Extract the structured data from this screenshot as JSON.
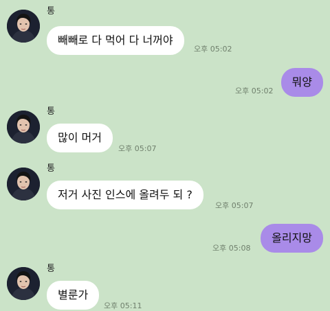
{
  "colors": {
    "background": "#cbe3c8",
    "incoming_bubble": "#ffffff",
    "outgoing_bubble": "#a98be8",
    "time_text": "#6f7f6c"
  },
  "messages": [
    {
      "sender": "통",
      "text": "빼빼로 다 먹어 다 너꺼야",
      "time": "오후 05:02",
      "direction": "in"
    },
    {
      "text": "뭐양",
      "time": "오후 05:02",
      "direction": "out"
    },
    {
      "sender": "통",
      "text": "많이 머거",
      "time": "오후 05:07",
      "direction": "in"
    },
    {
      "sender": "통",
      "text": "저거 사진 인스에 올려두 되 ?",
      "time": "오후 05:07",
      "direction": "in"
    },
    {
      "text": "올리지망",
      "time": "오후 05:08",
      "direction": "out"
    },
    {
      "sender": "통",
      "text": "별룬가",
      "time": "오후 05:11",
      "direction": "in"
    }
  ]
}
